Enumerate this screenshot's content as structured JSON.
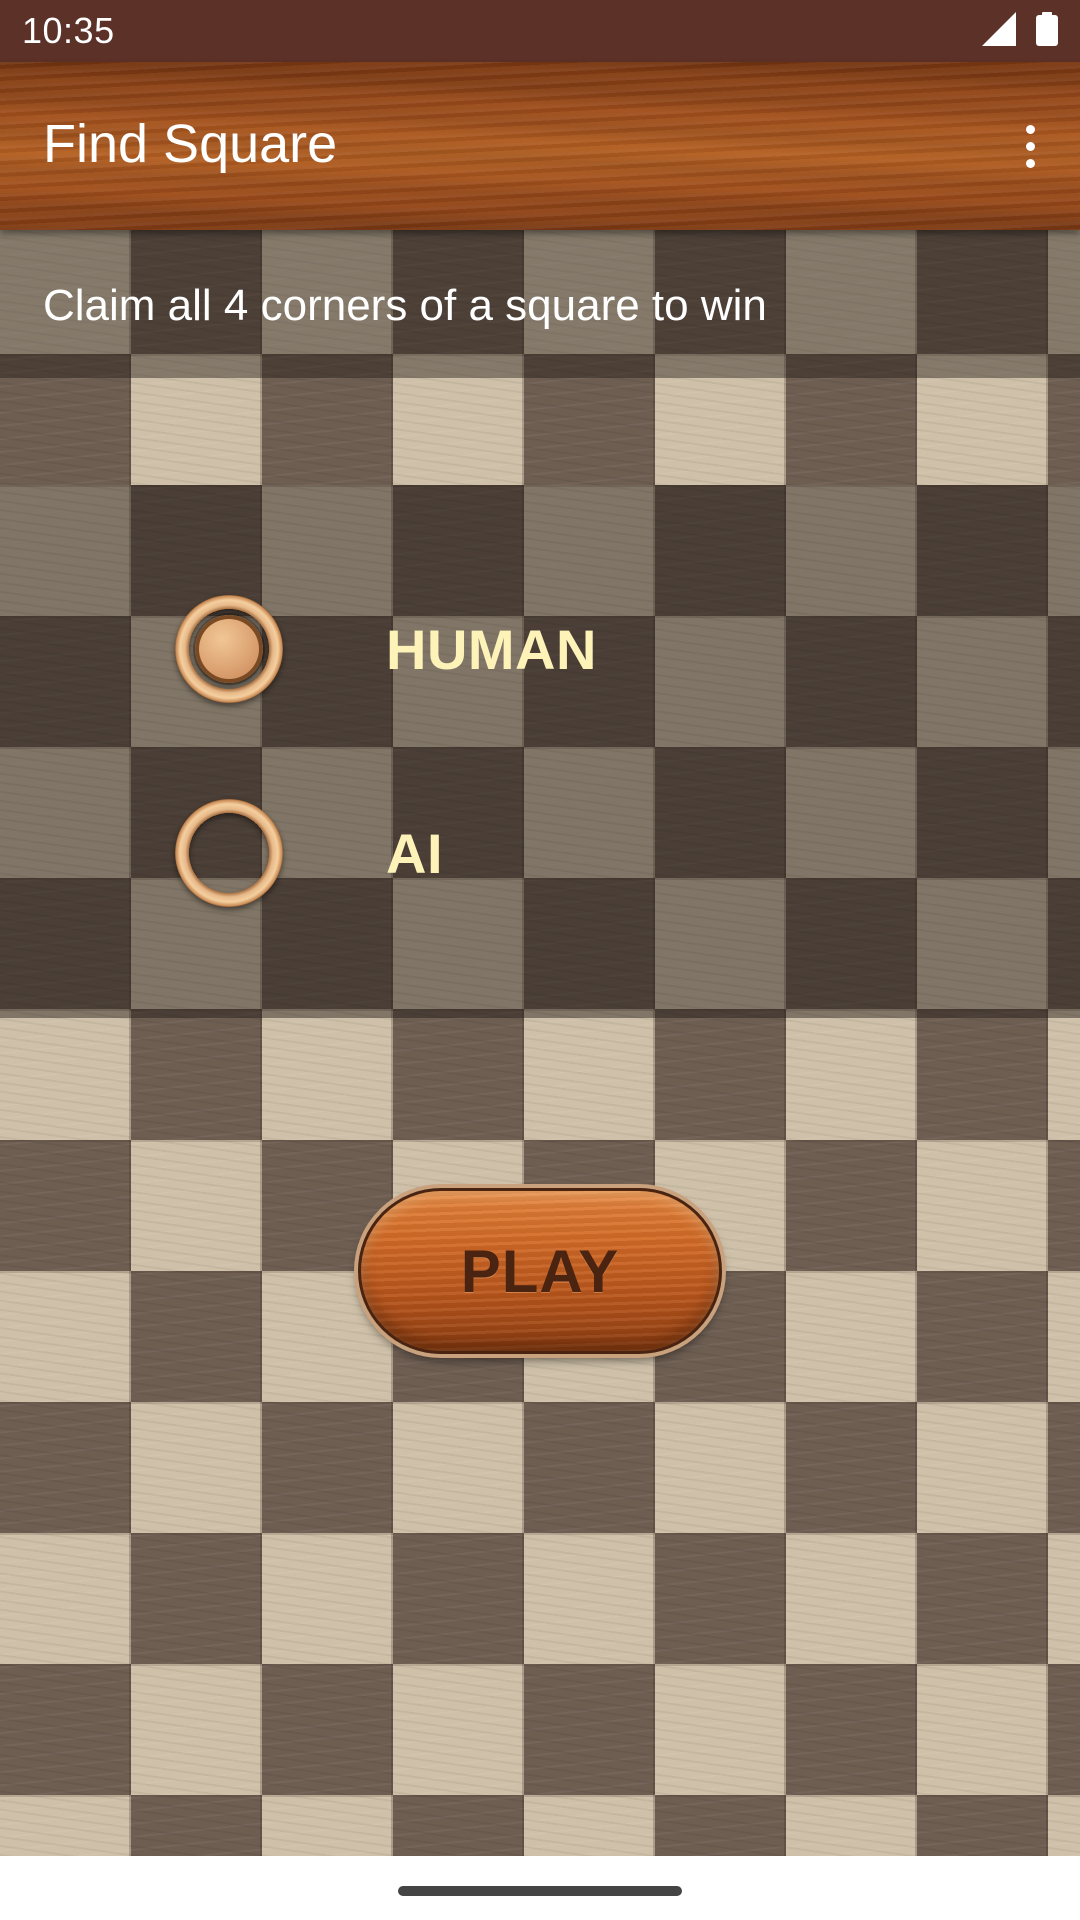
{
  "status_bar": {
    "time": "10:35",
    "icons": [
      "signal-icon",
      "battery-icon"
    ]
  },
  "app_bar": {
    "title": "Find Square",
    "overflow_icon": "more-vert-icon"
  },
  "instruction": "Claim all 4 corners of a square to win",
  "options": [
    {
      "label": "HUMAN",
      "selected": true
    },
    {
      "label": "AI",
      "selected": false
    }
  ],
  "play_button": {
    "label": "PLAY"
  },
  "colors": {
    "status_bar": "#5c3127",
    "option_label": "#fdf2b8",
    "play_label": "#4a2410"
  }
}
